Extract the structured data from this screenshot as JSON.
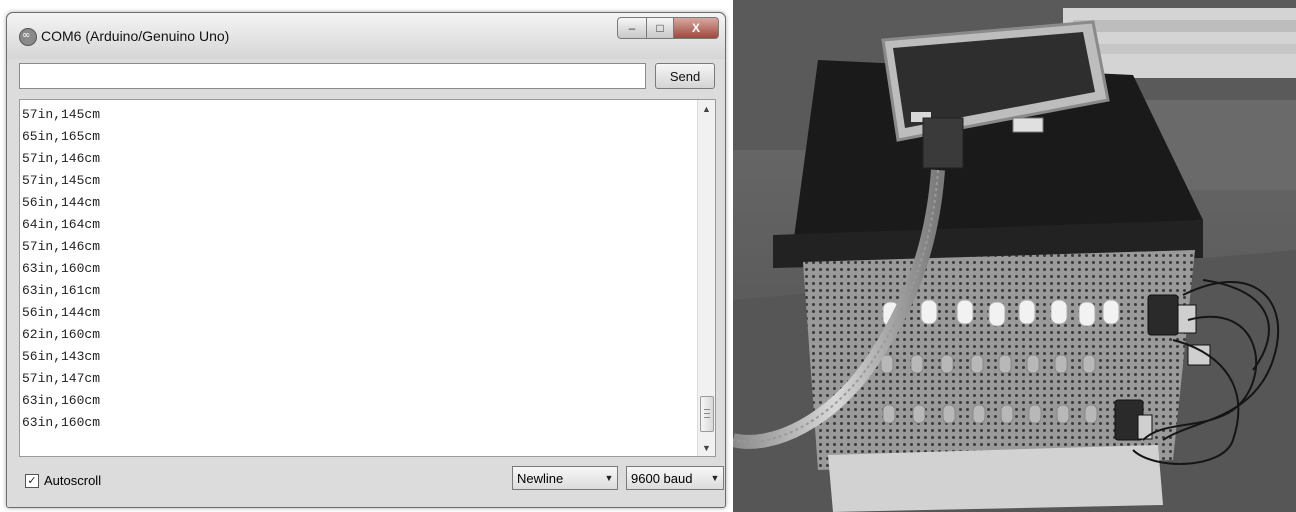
{
  "window": {
    "title": "COM6 (Arduino/Genuino Uno)",
    "controls": {
      "minimize": "–",
      "maximize": "□",
      "close": "X"
    }
  },
  "send_row": {
    "input_value": "",
    "send_label": "Send"
  },
  "serial_output": [
    "57in,145cm",
    "65in,165cm",
    "57in,146cm",
    "57in,145cm",
    "56in,144cm",
    "64in,164cm",
    "57in,146cm",
    "63in,160cm",
    "63in,161cm",
    "56in,144cm",
    "62in,160cm",
    "56in,143cm",
    "57in,147cm",
    "63in,160cm",
    "63in,160cm"
  ],
  "bottom_bar": {
    "autoscroll_label": "Autoscroll",
    "autoscroll_checked": true,
    "line_ending": "Newline",
    "baud_rate": "9600 baud"
  },
  "colors": {
    "window_bg": "#dcdcdc",
    "output_bg": "#ffffff",
    "close_button": "#9c4a3f"
  },
  "icons": [
    "arduino-icon",
    "minimize-icon",
    "maximize-icon",
    "close-icon",
    "scroll-up-icon",
    "scroll-down-icon",
    "dropdown-arrow-icon",
    "checkbox-checked-icon"
  ]
}
